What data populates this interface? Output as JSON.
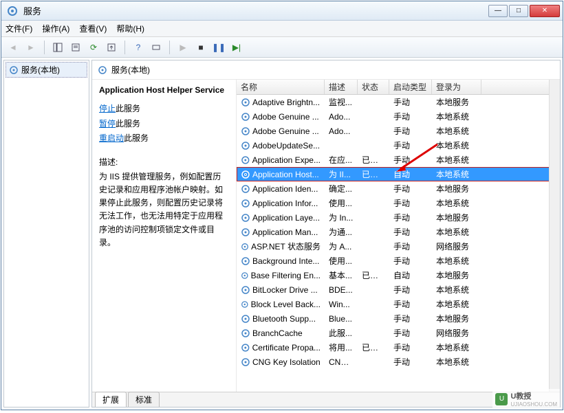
{
  "window": {
    "title": "服务"
  },
  "menu": {
    "file": "文件(F)",
    "action": "操作(A)",
    "view": "查看(V)",
    "help": "帮助(H)"
  },
  "tree": {
    "root": "服务(本地)"
  },
  "header": {
    "title": "服务(本地)"
  },
  "detail": {
    "name": "Application Host Helper Service",
    "stop_link": "停止",
    "stop_suffix": "此服务",
    "pause_link": "暂停",
    "pause_suffix": "此服务",
    "restart_link": "重启动",
    "restart_suffix": "此服务",
    "desc_label": "描述:",
    "desc_text": "为 IIS 提供管理服务，例如配置历史记录和应用程序池帐户映射。如果停止此服务，则配置历史记录将无法工作，也无法用特定于应用程序池的访问控制项锁定文件或目录。"
  },
  "columns": {
    "name": "名称",
    "desc": "描述",
    "status": "状态",
    "startup": "启动类型",
    "logon": "登录为"
  },
  "services": [
    {
      "name": "Adaptive Brightn...",
      "desc": "监视...",
      "status": "",
      "startup": "手动",
      "logon": "本地服务"
    },
    {
      "name": "Adobe Genuine ...",
      "desc": "Ado...",
      "status": "",
      "startup": "手动",
      "logon": "本地系统"
    },
    {
      "name": "Adobe Genuine ...",
      "desc": "Ado...",
      "status": "",
      "startup": "手动",
      "logon": "本地系统"
    },
    {
      "name": "AdobeUpdateSe...",
      "desc": "",
      "status": "",
      "startup": "手动",
      "logon": "本地系统"
    },
    {
      "name": "Application Expe...",
      "desc": "在应...",
      "status": "已启动",
      "startup": "手动",
      "logon": "本地系统"
    },
    {
      "name": "Application Host...",
      "desc": "为 II...",
      "status": "已启动",
      "startup": "自动",
      "logon": "本地系统",
      "selected": true
    },
    {
      "name": "Application Iden...",
      "desc": "确定...",
      "status": "",
      "startup": "手动",
      "logon": "本地服务"
    },
    {
      "name": "Application Infor...",
      "desc": "使用...",
      "status": "",
      "startup": "手动",
      "logon": "本地系统"
    },
    {
      "name": "Application Laye...",
      "desc": "为 In...",
      "status": "",
      "startup": "手动",
      "logon": "本地服务"
    },
    {
      "name": "Application Man...",
      "desc": "为通...",
      "status": "",
      "startup": "手动",
      "logon": "本地系统"
    },
    {
      "name": "ASP.NET 状态服务",
      "desc": "为 A...",
      "status": "",
      "startup": "手动",
      "logon": "网络服务"
    },
    {
      "name": "Background Inte...",
      "desc": "使用...",
      "status": "",
      "startup": "手动",
      "logon": "本地系统"
    },
    {
      "name": "Base Filtering En...",
      "desc": "基本...",
      "status": "已启动",
      "startup": "自动",
      "logon": "本地服务"
    },
    {
      "name": "BitLocker Drive ...",
      "desc": "BDE...",
      "status": "",
      "startup": "手动",
      "logon": "本地系统"
    },
    {
      "name": "Block Level Back...",
      "desc": "Win...",
      "status": "",
      "startup": "手动",
      "logon": "本地系统"
    },
    {
      "name": "Bluetooth Supp...",
      "desc": "Blue...",
      "status": "",
      "startup": "手动",
      "logon": "本地服务"
    },
    {
      "name": "BranchCache",
      "desc": "此服...",
      "status": "",
      "startup": "手动",
      "logon": "网络服务"
    },
    {
      "name": "Certificate Propa...",
      "desc": "将用...",
      "status": "已启动",
      "startup": "手动",
      "logon": "本地系统"
    },
    {
      "name": "CNG Key Isolation",
      "desc": "CNG...",
      "status": "",
      "startup": "手动",
      "logon": "本地系统"
    }
  ],
  "tabs": {
    "extended": "扩展",
    "standard": "标准"
  },
  "watermark": {
    "brand": "U教授",
    "url": "UJIAOSHOU.COM"
  }
}
